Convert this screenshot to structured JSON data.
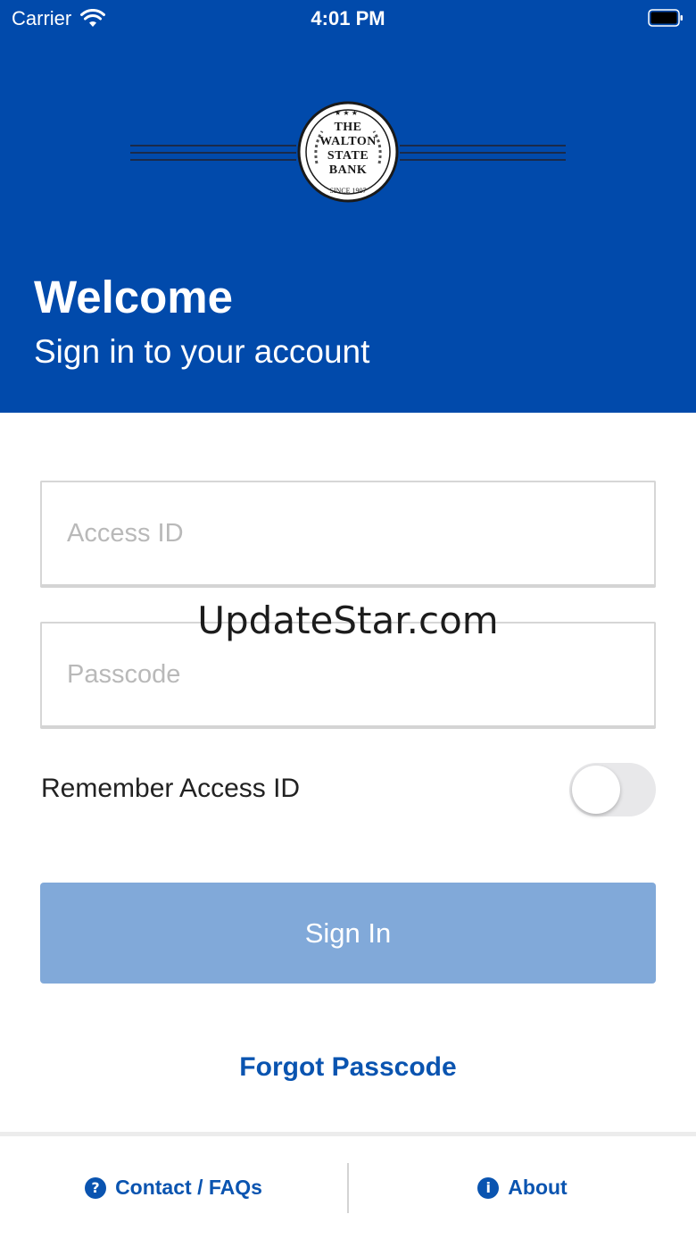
{
  "status_bar": {
    "carrier": "Carrier",
    "time": "4:01 PM",
    "wifi_icon": "wifi-icon",
    "battery_icon": "battery-icon"
  },
  "logo": {
    "line1": "THE",
    "line2": "WALTON",
    "line3": "STATE",
    "line4": "BANK",
    "since": "SINCE 1907"
  },
  "header": {
    "title": "Welcome",
    "subtitle": "Sign in to your account",
    "color": "#014aab"
  },
  "form": {
    "access_id_placeholder": "Access ID",
    "access_id_value": "",
    "passcode_placeholder": "Passcode",
    "passcode_value": "",
    "remember_label": "Remember Access ID",
    "remember_enabled": false,
    "signin_label": "Sign In",
    "signin_color": "#81a9d9",
    "forgot_label": "Forgot Passcode"
  },
  "watermark": "UpdateStar.com",
  "footer": {
    "contact_label": "Contact / FAQs",
    "contact_icon": "question-circle-icon",
    "contact_icon_glyph": "?",
    "about_label": "About",
    "about_icon": "info-circle-icon",
    "about_icon_glyph": "i",
    "link_color": "#0a54b0"
  }
}
